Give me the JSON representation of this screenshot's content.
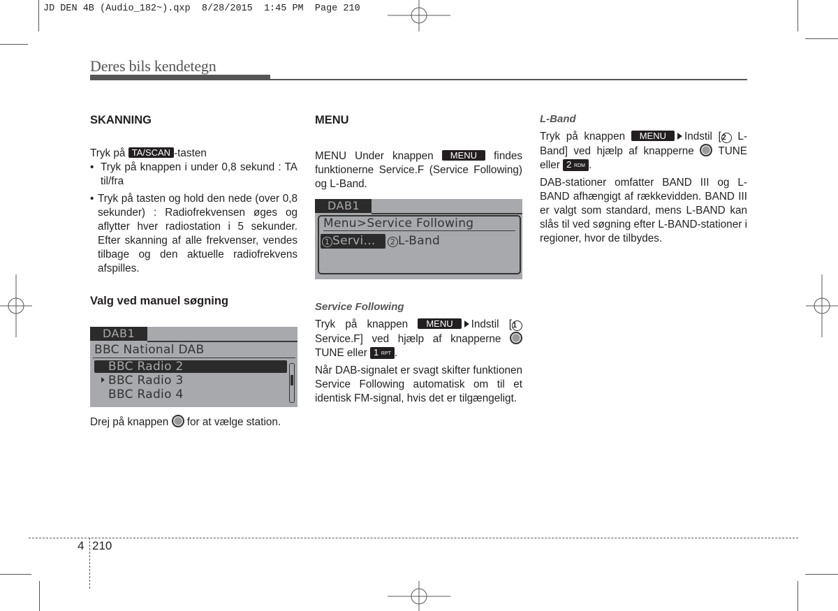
{
  "slug": "JD DEN 4B (Audio_182~).qxp  8/28/2015  1:45 PM  Page 210",
  "running_header": "Deres bils kendetegn",
  "col1": {
    "heading": "SKANNING",
    "intro_pre": "Tryk på ",
    "intro_key": "TA/SCAN",
    "intro_post": "-tasten",
    "bullets": [
      "Tryk på knappen i under 0,8 sekund : TA til/fra",
      "Tryk på tasten og hold den nede (over 0,8 sekunder) : Radiofrekvensen øges og aflytter hver radiostation i 5 sekunder. Efter skanning af alle frekvenser, vendes tilbage og den aktuelle radiofrekvens afspilles."
    ],
    "subheading": "Valg ved manuel søgning",
    "screen": {
      "tab": "DAB1",
      "title": "BBC National DAB",
      "items": [
        "BBC Radio 2",
        "BBC Radio 3",
        "BBC Radio 4"
      ],
      "selected_index": 0,
      "playing_index": 1
    },
    "caption_pre": "Drej på knappen ",
    "caption_post": " for at vælge station."
  },
  "col2": {
    "heading": "MENU",
    "intro_pre": "MENU Under knappen ",
    "intro_key": "MENU",
    "intro_post": " findes funktionerne Service.F (Service Following) og L-Band.",
    "screen": {
      "tab": "DAB1",
      "title": "Menu>Service Following",
      "options": [
        {
          "num": "1",
          "label": "Servi...",
          "selected": true
        },
        {
          "num": "2",
          "label": "L-Band",
          "selected": false
        }
      ]
    },
    "subheading": "Service Following",
    "step_pre": "Tryk på knappen ",
    "step_key": "MENU",
    "step_mid": "Indstil [",
    "step_num": "1",
    "step_post": "Service.F] ved hjælp af knapperne",
    "step_tune": "TUNE eller ",
    "step_key2_num": "1",
    "step_key2_label": "RPT",
    "step_end": ".",
    "paragraph": "Når DAB-signalet er svagt skifter funktionen Service Following automatisk om til et identisk FM-signal, hvis det er tilgængeligt."
  },
  "col3": {
    "subheading": "L-Band",
    "step_pre": "Tryk på knappen ",
    "step_key": "MENU",
    "step_mid": "Indstil [",
    "step_num": "2",
    "step_post": "L-Band] ved hjælp af knapperne",
    "step_tune": "TUNE eller ",
    "step_key2_num": "2",
    "step_key2_label": "RDM",
    "step_end": ".",
    "paragraph": "DAB-stationer omfatter BAND III og L-BAND afhængigt af rækkevidden. BAND III er valgt som standard, mens L-BAND kan slås til ved søgning efter L-BAND-stationer i regioner, hvor de tilbydes."
  },
  "footer": {
    "chapter": "4",
    "page": "210"
  }
}
